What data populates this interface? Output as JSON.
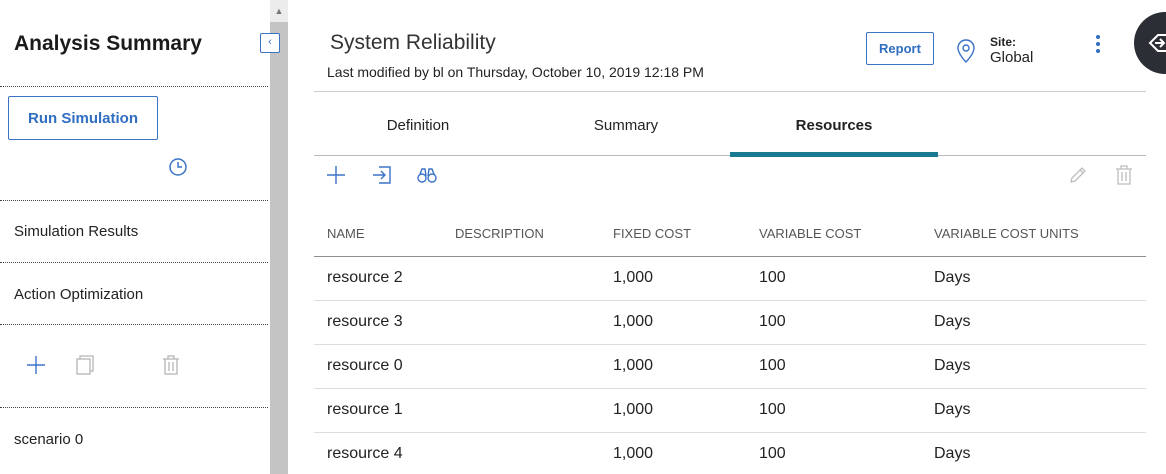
{
  "left_panel": {
    "title": "Analysis Summary",
    "run_button": "Run Simulation",
    "items": [
      {
        "label": "Simulation Results"
      },
      {
        "label": "Action Optimization"
      }
    ],
    "scenario": "scenario 0"
  },
  "header": {
    "title": "System Reliability",
    "modified": "Last modified by bl on Thursday, October 10, 2019 12:18 PM",
    "report_button": "Report",
    "site_label": "Site:",
    "site_value": "Global"
  },
  "tabs": [
    {
      "label": "Definition",
      "active": false
    },
    {
      "label": "Summary",
      "active": false
    },
    {
      "label": "Resources",
      "active": true
    }
  ],
  "table": {
    "columns": [
      "NAME",
      "DESCRIPTION",
      "FIXED COST",
      "VARIABLE COST",
      "VARIABLE COST UNITS"
    ],
    "rows": [
      [
        "resource 2",
        "",
        "1,000",
        "100",
        "Days"
      ],
      [
        "resource 3",
        "",
        "1,000",
        "100",
        "Days"
      ],
      [
        "resource 0",
        "",
        "1,000",
        "100",
        "Days"
      ],
      [
        "resource 1",
        "",
        "1,000",
        "100",
        "Days"
      ],
      [
        "resource 4",
        "",
        "1,000",
        "100",
        "Days"
      ]
    ]
  },
  "icons": {
    "clock": "clock-icon",
    "add": "plus-icon",
    "copy": "copy-icon",
    "delete": "trash-icon",
    "import": "import-icon",
    "search": "binoculars-icon",
    "edit": "pencil-icon",
    "location": "location-pin-icon",
    "more": "kebab-menu-icon",
    "side_panel": "side-panel-toggle-icon"
  },
  "colors": {
    "accent": "#2f6ec0",
    "active_tab_underline": "#1a7a92",
    "side_button": "#2b2f35"
  }
}
